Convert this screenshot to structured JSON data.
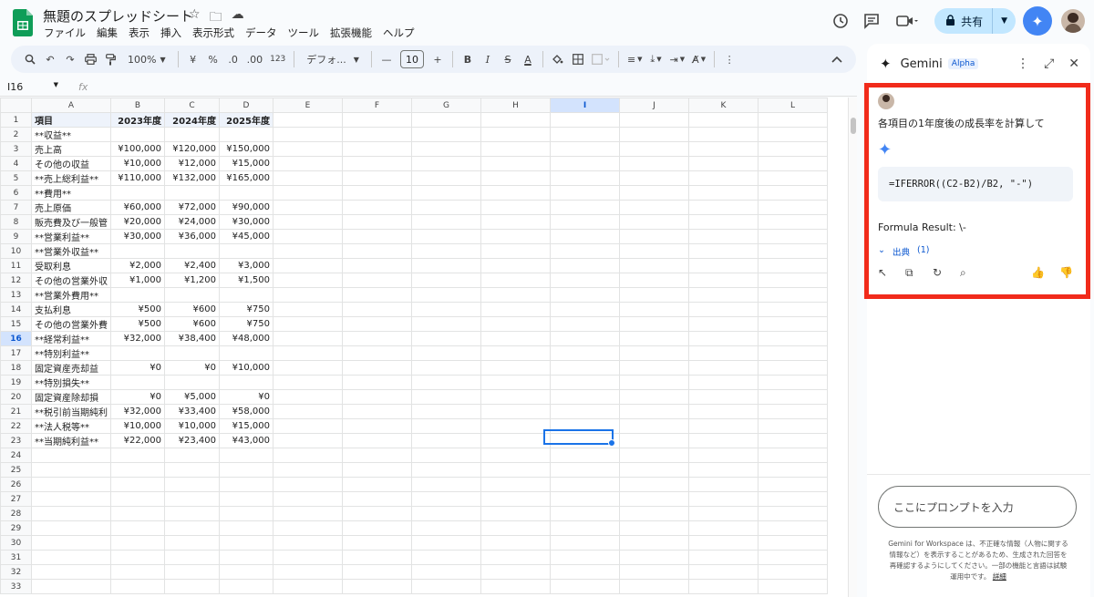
{
  "doc": {
    "title": "無題のスプレッドシート",
    "menu": [
      "ファイル",
      "編集",
      "表示",
      "挿入",
      "表示形式",
      "データ",
      "ツール",
      "拡張機能",
      "ヘルプ"
    ]
  },
  "top_right": {
    "share_label": "共有"
  },
  "toolbar": {
    "zoom": "100%",
    "currency": "¥",
    "percent": "%",
    "dec_decrease": ".0",
    "dec_increase": ".00",
    "number_format": "123",
    "font_name": "デフォ...",
    "font_size": "10"
  },
  "formula_bar": {
    "cell_ref": "I16",
    "fx": "fx"
  },
  "grid": {
    "columns": [
      "A",
      "B",
      "C",
      "D",
      "E",
      "F",
      "G",
      "H",
      "I",
      "J",
      "K",
      "L"
    ],
    "selected_col": "I",
    "selected_row": 16,
    "rows": [
      {
        "n": "1",
        "cells": [
          "項目",
          "2023年度",
          "2024年度",
          "2025年度"
        ],
        "hdr": true
      },
      {
        "n": "2",
        "cells": [
          "**収益**",
          "",
          "",
          ""
        ]
      },
      {
        "n": "3",
        "cells": [
          "売上高",
          "¥100,000",
          "¥120,000",
          "¥150,000"
        ]
      },
      {
        "n": "4",
        "cells": [
          "その他の収益",
          "¥10,000",
          "¥12,000",
          "¥15,000"
        ]
      },
      {
        "n": "5",
        "cells": [
          "**売上総利益**",
          "¥110,000",
          "¥132,000",
          "¥165,000"
        ]
      },
      {
        "n": "6",
        "cells": [
          "**費用**",
          "",
          "",
          ""
        ]
      },
      {
        "n": "7",
        "cells": [
          "売上原価",
          "¥60,000",
          "¥72,000",
          "¥90,000"
        ]
      },
      {
        "n": "8",
        "cells": [
          "販売費及び一般管",
          "¥20,000",
          "¥24,000",
          "¥30,000"
        ]
      },
      {
        "n": "9",
        "cells": [
          "**営業利益**",
          "¥30,000",
          "¥36,000",
          "¥45,000"
        ]
      },
      {
        "n": "10",
        "cells": [
          "**営業外収益**",
          "",
          "",
          ""
        ]
      },
      {
        "n": "11",
        "cells": [
          "受取利息",
          "¥2,000",
          "¥2,400",
          "¥3,000"
        ]
      },
      {
        "n": "12",
        "cells": [
          "その他の営業外収",
          "¥1,000",
          "¥1,200",
          "¥1,500"
        ]
      },
      {
        "n": "13",
        "cells": [
          "**営業外費用**",
          "",
          "",
          ""
        ]
      },
      {
        "n": "14",
        "cells": [
          "支払利息",
          "¥500",
          "¥600",
          "¥750"
        ]
      },
      {
        "n": "15",
        "cells": [
          "その他の営業外費",
          "¥500",
          "¥600",
          "¥750"
        ]
      },
      {
        "n": "16",
        "cells": [
          "**経常利益**",
          "¥32,000",
          "¥38,400",
          "¥48,000"
        ]
      },
      {
        "n": "17",
        "cells": [
          "**特別利益**",
          "",
          "",
          ""
        ]
      },
      {
        "n": "18",
        "cells": [
          "固定資産売却益",
          "¥0",
          "¥0",
          "¥10,000"
        ]
      },
      {
        "n": "19",
        "cells": [
          "**特別損失**",
          "",
          "",
          ""
        ]
      },
      {
        "n": "20",
        "cells": [
          "固定資産除却損",
          "¥0",
          "¥5,000",
          "¥0"
        ]
      },
      {
        "n": "21",
        "cells": [
          "**税引前当期純利",
          "¥32,000",
          "¥33,400",
          "¥58,000"
        ]
      },
      {
        "n": "22",
        "cells": [
          "**法人税等**",
          "¥10,000",
          "¥10,000",
          "¥15,000"
        ]
      },
      {
        "n": "23",
        "cells": [
          "**当期純利益**",
          "¥22,000",
          "¥23,400",
          "¥43,000"
        ]
      },
      {
        "n": "24",
        "cells": [
          "",
          "",
          "",
          ""
        ]
      },
      {
        "n": "25",
        "cells": [
          "",
          "",
          "",
          ""
        ]
      },
      {
        "n": "26",
        "cells": [
          "",
          "",
          "",
          ""
        ]
      },
      {
        "n": "27",
        "cells": [
          "",
          "",
          "",
          ""
        ]
      },
      {
        "n": "28",
        "cells": [
          "",
          "",
          "",
          ""
        ]
      },
      {
        "n": "29",
        "cells": [
          "",
          "",
          "",
          ""
        ]
      },
      {
        "n": "30",
        "cells": [
          "",
          "",
          "",
          ""
        ]
      },
      {
        "n": "31",
        "cells": [
          "",
          "",
          "",
          ""
        ]
      },
      {
        "n": "32",
        "cells": [
          "",
          "",
          "",
          ""
        ]
      },
      {
        "n": "33",
        "cells": [
          "",
          "",
          "",
          ""
        ]
      }
    ]
  },
  "gemini": {
    "title": "Gemini",
    "badge": "Alpha",
    "prompt": "各項目の1年度後の成長率を計算して",
    "formula": "=IFERROR((C2-B2)/B2, \"-\")",
    "result": "Formula Result: \\-",
    "sources_label": "出典",
    "sources_count": "(1)",
    "input_placeholder": "ここにプロンプトを入力",
    "disclaimer": "Gemini for Workspace は、不正確な情報（人物に関する情報など）を表示することがあるため、生成された回答を再確認するようにしてください。一部の機能と言語は試験運用中です。",
    "disclaimer_link": "詳細"
  },
  "colors": {
    "accent": "#1a73e8",
    "highlight_border": "#f12b1b",
    "share_bg": "#c2e7ff"
  }
}
